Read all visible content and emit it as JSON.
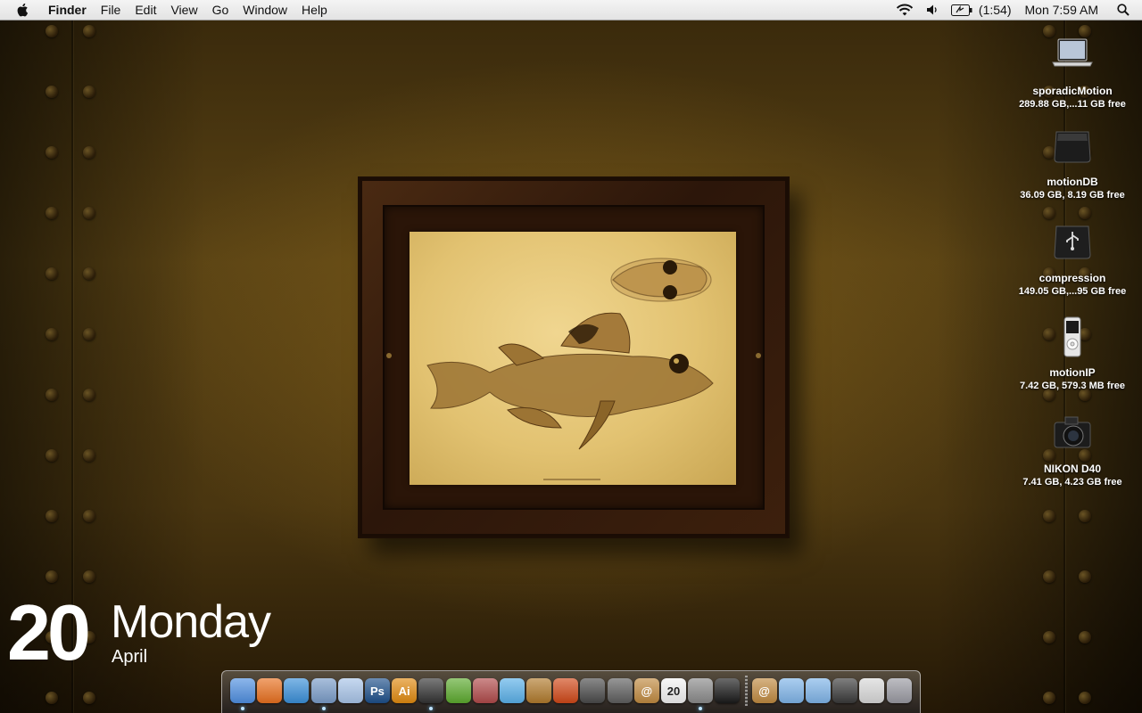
{
  "menubar": {
    "app_name": "Finder",
    "items": [
      "File",
      "Edit",
      "View",
      "Go",
      "Window",
      "Help"
    ],
    "battery_time": "(1:54)",
    "clock": "Mon 7:59 AM"
  },
  "desktop_icons": [
    {
      "name": "sporadicMotion",
      "info": "289.88 GB,...11 GB free",
      "icon": "laptop-icon"
    },
    {
      "name": "motionDB",
      "info": "36.09 GB, 8.19 GB free",
      "icon": "external-drive-icon"
    },
    {
      "name": "compression",
      "info": "149.05 GB,...95 GB free",
      "icon": "usb-drive-icon"
    },
    {
      "name": "motionIP",
      "info": "7.42 GB, 579.3 MB free",
      "icon": "ipod-icon"
    },
    {
      "name": "NIKON D40",
      "info": "7.41 GB, 4.23 GB free",
      "icon": "camera-icon"
    }
  ],
  "date_widget": {
    "day": "20",
    "weekday": "Monday",
    "month": "April"
  },
  "dock": {
    "apps": [
      {
        "icon": "finder-icon",
        "label": "",
        "color": "#4f8fe0",
        "running": true
      },
      {
        "icon": "firefox-icon",
        "label": "",
        "color": "#e8701f",
        "running": false
      },
      {
        "icon": "safari-icon",
        "label": "",
        "color": "#3a8fd8",
        "running": false
      },
      {
        "icon": "mail-icon",
        "label": "",
        "color": "#7a9cc8",
        "running": true
      },
      {
        "icon": "ichat-icon",
        "label": "",
        "color": "#a8c4e8",
        "running": false
      },
      {
        "icon": "photoshop-icon",
        "label": "Ps",
        "color": "#1d4f8a",
        "running": false
      },
      {
        "icon": "illustrator-icon",
        "label": "Ai",
        "color": "#e08a10",
        "running": false
      },
      {
        "icon": "aperture-icon",
        "label": "",
        "color": "#333333",
        "running": true
      },
      {
        "icon": "coda-icon",
        "label": "",
        "color": "#5caa2e",
        "running": false
      },
      {
        "icon": "textmate-icon",
        "label": "",
        "color": "#b04a4a",
        "running": false
      },
      {
        "icon": "itunes-icon",
        "label": "",
        "color": "#5ab0e8",
        "running": false
      },
      {
        "icon": "garageband-icon",
        "label": "",
        "color": "#b07a2c",
        "running": false
      },
      {
        "icon": "cinema4d-icon",
        "label": "",
        "color": "#d04818",
        "running": false
      },
      {
        "icon": "imovie-icon",
        "label": "",
        "color": "#4a4a4a",
        "running": false
      },
      {
        "icon": "motion-icon",
        "label": "",
        "color": "#5e5e5e",
        "running": false
      },
      {
        "icon": "address-book-icon",
        "label": "@",
        "color": "#c08a40",
        "running": false
      },
      {
        "icon": "ical-icon",
        "label": "20",
        "color": "#f2f2f2",
        "running": false
      },
      {
        "icon": "system-preferences-icon",
        "label": "",
        "color": "#8a8a8a",
        "running": true
      },
      {
        "icon": "terminal-icon",
        "label": "",
        "color": "#1a1a1a",
        "running": false
      }
    ],
    "docs": [
      {
        "icon": "address-book-doc-icon",
        "label": "@",
        "color": "#c08a40"
      },
      {
        "icon": "folder-icon",
        "label": "",
        "color": "#7fb4e8"
      },
      {
        "icon": "folder-icon",
        "label": "",
        "color": "#7fb4e8"
      },
      {
        "icon": "media-folder-icon",
        "label": "",
        "color": "#3a3a3a"
      },
      {
        "icon": "calculator-icon",
        "label": "",
        "color": "#d8d8d8"
      },
      {
        "icon": "trash-icon",
        "label": "",
        "color": "#9a9aa2"
      }
    ]
  }
}
